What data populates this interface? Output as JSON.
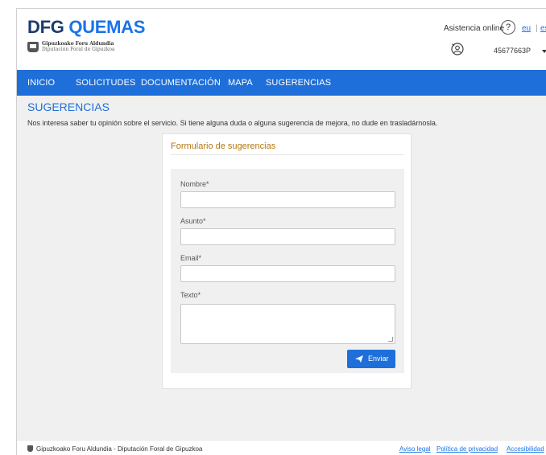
{
  "header": {
    "brand_dfg": "DFG",
    "brand_quemas": "QUEMAS",
    "org_line1": "Gipuzkoako Foru Aldundia",
    "org_line2": "Diputación Foral de Gipuzkoa",
    "assist_label": "Asistencia online",
    "help_symbol": "?",
    "lang_eu": "eu",
    "lang_sep": "|",
    "lang_es": "es",
    "user_id": "45677663P"
  },
  "nav": {
    "items": [
      "INICIO",
      "SOLICITUDES",
      "DOCUMENTACIÓN",
      "MAPA",
      "SUGERENCIAS"
    ]
  },
  "page": {
    "title": "SUGERENCIAS",
    "intro": "Nos interesa saber tu opinión sobre el servicio. Si tiene alguna duda o alguna sugerencia de mejora, no dude en trasladárnosla."
  },
  "form": {
    "title": "Formulario de sugerencias",
    "fields": [
      {
        "label": "Nombre*",
        "value": ""
      },
      {
        "label": "Asunto*",
        "value": ""
      },
      {
        "label": "Email*",
        "value": ""
      },
      {
        "label": "Texto*",
        "value": ""
      }
    ],
    "submit_label": "Enviar"
  },
  "footer": {
    "org": "Gipuzkoako Foru Aldundia - Diputación Foral de Gipuzkoa",
    "links": [
      "Aviso legal",
      "Política de privacidad",
      "Accesibilidad"
    ]
  },
  "colors": {
    "brand_blue": "#1e6fd9",
    "brand_dark": "#1d3c6e",
    "form_title": "#b5760b",
    "background": "#f0f0f0"
  },
  "icons": [
    "help-icon",
    "user-icon",
    "send-icon",
    "caret-down-icon",
    "emblem-icon"
  ]
}
